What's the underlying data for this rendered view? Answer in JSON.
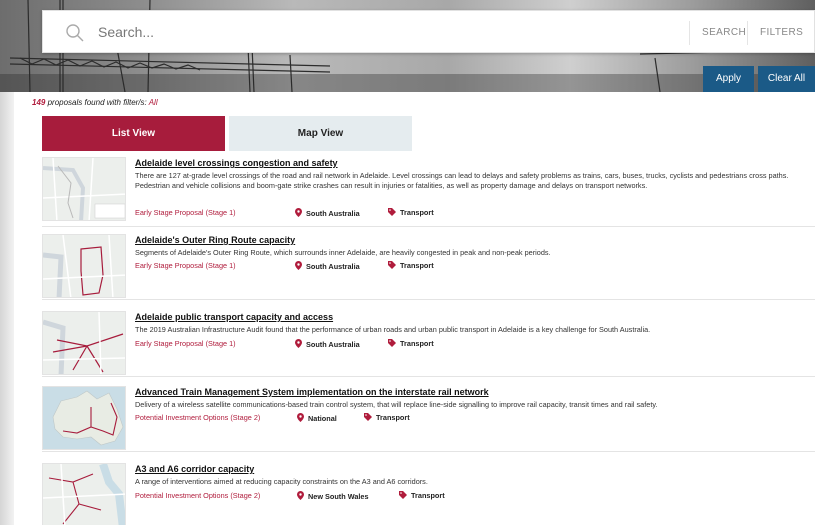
{
  "search": {
    "placeholder": "Search...",
    "search_label": "SEARCH",
    "filters_label": "FILTERS",
    "apply_label": "Apply",
    "clear_label": "Clear All"
  },
  "results": {
    "count": "149",
    "text": "proposals found with filter/s:",
    "filter": "All"
  },
  "views": {
    "list_label": "List View",
    "map_label": "Map View"
  },
  "colors": {
    "accent": "#a71c3c",
    "button": "#1b5a87"
  },
  "proposals": [
    {
      "title": "Adelaide level crossings congestion and safety",
      "description": "There are 127 at-grade level crossings of the road and rail network in Adelaide. Level crossings can lead to delays and safety problems as trains, cars, buses, trucks, cyclists and pedestrians cross paths. Pedestrian and vehicle collisions and boom-gate strike crashes can result in injuries or fatalities, as well as property damage and delays on transport networks.",
      "stage": "Early Stage Proposal (Stage 1)",
      "location": "South Australia",
      "category": "Transport"
    },
    {
      "title": "Adelaide's Outer Ring Route capacity",
      "description": "Segments of Adelaide's Outer Ring Route, which surrounds inner Adelaide, are heavily congested in peak and non-peak periods.",
      "stage": "Early Stage Proposal (Stage 1)",
      "location": "South Australia",
      "category": "Transport"
    },
    {
      "title": "Adelaide public transport capacity and access",
      "description": "The 2019 Australian Infrastructure Audit found that the performance of urban roads and urban public transport in Adelaide is a key challenge for South Australia.",
      "stage": "Early Stage Proposal (Stage 1)",
      "location": "South Australia",
      "category": "Transport"
    },
    {
      "title": "Advanced Train Management System implementation on the interstate rail network",
      "description": "Delivery of a wireless satellite communications-based train control system, that will replace line-side signalling to improve rail capacity, transit times and rail safety.",
      "stage": "Potential Investment Options (Stage 2)",
      "location": "National",
      "category": "Transport"
    },
    {
      "title": "A3 and A6 corridor capacity",
      "description": "A range of interventions aimed at reducing capacity constraints on the A3 and A6 corridors.",
      "stage": "Potential Investment Options (Stage 2)",
      "location": "New South Wales",
      "category": "Transport"
    }
  ]
}
